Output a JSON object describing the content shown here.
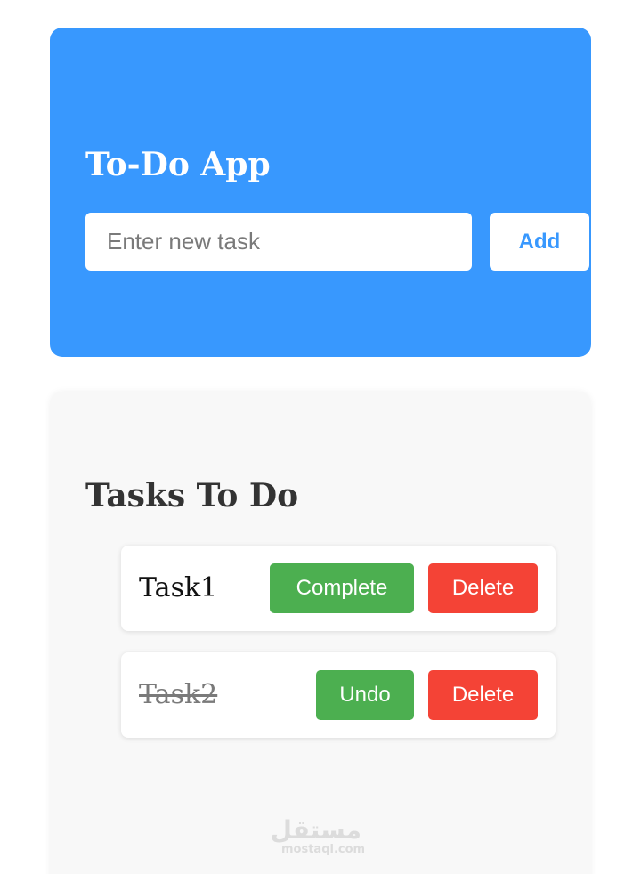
{
  "header": {
    "title": "To-Do App",
    "input_placeholder": "Enter new task",
    "input_value": "",
    "add_label": "Add"
  },
  "tasks_section": {
    "title": "Tasks To Do",
    "tasks": [
      {
        "text": "Task1",
        "completed": false,
        "toggle_label": "Complete",
        "delete_label": "Delete"
      },
      {
        "text": "Task2",
        "completed": true,
        "toggle_label": "Undo",
        "delete_label": "Delete"
      }
    ]
  },
  "watermark": {
    "arabic": "مستقل",
    "latin": "mostaql.com"
  },
  "colors": {
    "header_bg": "#3898fe",
    "list_bg": "#f8f8f8",
    "complete_green": "#4caf50",
    "delete_red": "#f44336",
    "completed_text": "#7a7a7a"
  }
}
